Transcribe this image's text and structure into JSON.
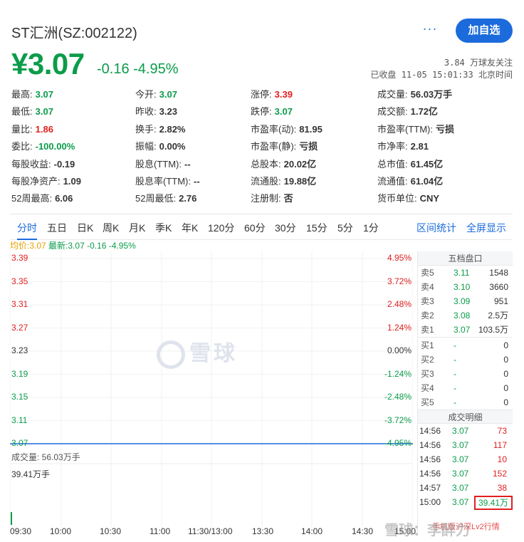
{
  "header": {
    "stock_name": "ST汇洲(SZ:002122)",
    "more_label": "···",
    "follow_label": "加自选"
  },
  "quote": {
    "price": "¥3.07",
    "change": "-0.16 -4.95%",
    "followers": "3.84 万球友关注",
    "status": "已收盘 11-05 15:01:33 北京时间"
  },
  "stats": [
    {
      "label": "最高:",
      "value": "3.07",
      "color": "green"
    },
    {
      "label": "今开:",
      "value": "3.07",
      "color": "green"
    },
    {
      "label": "涨停:",
      "value": "3.39",
      "color": "red"
    },
    {
      "label": "成交量:",
      "value": "56.03万手",
      "color": "grey"
    },
    {
      "label": "最低:",
      "value": "3.07",
      "color": "green"
    },
    {
      "label": "昨收:",
      "value": "3.23",
      "color": "grey"
    },
    {
      "label": "跌停:",
      "value": "3.07",
      "color": "green"
    },
    {
      "label": "成交额:",
      "value": "1.72亿",
      "color": "grey"
    },
    {
      "label": "量比:",
      "value": "1.86",
      "color": "red"
    },
    {
      "label": "换手:",
      "value": "2.82%",
      "color": "grey"
    },
    {
      "label": "市盈率(动):",
      "value": "81.95",
      "color": "grey"
    },
    {
      "label": "市盈率(TTM):",
      "value": "亏损",
      "color": "grey"
    },
    {
      "label": "委比:",
      "value": "-100.00%",
      "color": "green"
    },
    {
      "label": "振幅:",
      "value": "0.00%",
      "color": "grey"
    },
    {
      "label": "市盈率(静):",
      "value": "亏损",
      "color": "grey"
    },
    {
      "label": "市净率:",
      "value": "2.81",
      "color": "grey"
    },
    {
      "label": "每股收益:",
      "value": "-0.19",
      "color": "grey"
    },
    {
      "label": "股息(TTM):",
      "value": "--",
      "color": "grey"
    },
    {
      "label": "总股本:",
      "value": "20.02亿",
      "color": "grey"
    },
    {
      "label": "总市值:",
      "value": "61.45亿",
      "color": "grey"
    },
    {
      "label": "每股净资产:",
      "value": "1.09",
      "color": "grey"
    },
    {
      "label": "股息率(TTM):",
      "value": "--",
      "color": "grey"
    },
    {
      "label": "流通股:",
      "value": "19.88亿",
      "color": "grey"
    },
    {
      "label": "流通值:",
      "value": "61.04亿",
      "color": "grey"
    },
    {
      "label": "52周最高:",
      "value": "6.06",
      "color": "grey"
    },
    {
      "label": "52周最低:",
      "value": "2.76",
      "color": "grey"
    },
    {
      "label": "注册制:",
      "value": "否",
      "color": "grey"
    },
    {
      "label": "货币单位:",
      "value": "CNY",
      "color": "grey"
    }
  ],
  "tabs": [
    "分时",
    "五日",
    "日K",
    "周K",
    "月K",
    "季K",
    "年K",
    "120分",
    "60分",
    "30分",
    "15分",
    "5分",
    "1分"
  ],
  "tab_right": [
    "区间统计",
    "全屏显示"
  ],
  "chart_legend": {
    "avg": "均价:3.07",
    "latest": "最新:3.07 -0.16 -4.95%"
  },
  "watermark": "雪球",
  "chart_data": {
    "type": "line",
    "y_labels_left": [
      "3.39",
      "3.35",
      "3.31",
      "3.27",
      "3.23",
      "3.19",
      "3.15",
      "3.11",
      "3.07"
    ],
    "y_labels_right": [
      "4.95%",
      "3.72%",
      "2.48%",
      "1.24%",
      "0.00%",
      "-1.24%",
      "-2.48%",
      "-3.72%",
      "-4.95%"
    ],
    "ylim": [
      3.07,
      3.39
    ],
    "x_labels": [
      "09:30",
      "10:00",
      "10:30",
      "11:00",
      "11:30/13:00",
      "13:30",
      "14:00",
      "14:30",
      "15:00"
    ],
    "series": [
      {
        "values": [
          3.07,
          3.07,
          3.07,
          3.07,
          3.07,
          3.07,
          3.07,
          3.07,
          3.07
        ]
      }
    ],
    "volume": {
      "title": "成交量: 56.03万手",
      "max_label": "39.41万手"
    }
  },
  "orderbook": {
    "title": "五档盘口",
    "asks": [
      {
        "label": "卖5",
        "price": "3.11",
        "vol": "1548"
      },
      {
        "label": "卖4",
        "price": "3.10",
        "vol": "3660"
      },
      {
        "label": "卖3",
        "price": "3.09",
        "vol": "951"
      },
      {
        "label": "卖2",
        "price": "3.08",
        "vol": "2.5万"
      },
      {
        "label": "卖1",
        "price": "3.07",
        "vol": "103.5万"
      }
    ],
    "bids": [
      {
        "label": "买1",
        "price": "-",
        "vol": "0"
      },
      {
        "label": "买2",
        "price": "-",
        "vol": "0"
      },
      {
        "label": "买3",
        "price": "-",
        "vol": "0"
      },
      {
        "label": "买4",
        "price": "-",
        "vol": "0"
      },
      {
        "label": "买5",
        "price": "-",
        "vol": "0"
      }
    ],
    "trades_title": "成交明细",
    "trades": [
      {
        "time": "14:56",
        "price": "3.07",
        "vol": "73",
        "color": "red"
      },
      {
        "time": "14:56",
        "price": "3.07",
        "vol": "117",
        "color": "red"
      },
      {
        "time": "14:56",
        "price": "3.07",
        "vol": "10",
        "color": "red"
      },
      {
        "time": "14:56",
        "price": "3.07",
        "vol": "152",
        "color": "red"
      },
      {
        "time": "14:57",
        "price": "3.07",
        "vol": "38",
        "color": "red"
      },
      {
        "time": "15:00",
        "price": "3.07",
        "vol": "39.41万",
        "color": "green"
      }
    ],
    "footer": "手机版沪深Lv2行情"
  },
  "corner_watermark": "雪球：李醉力"
}
